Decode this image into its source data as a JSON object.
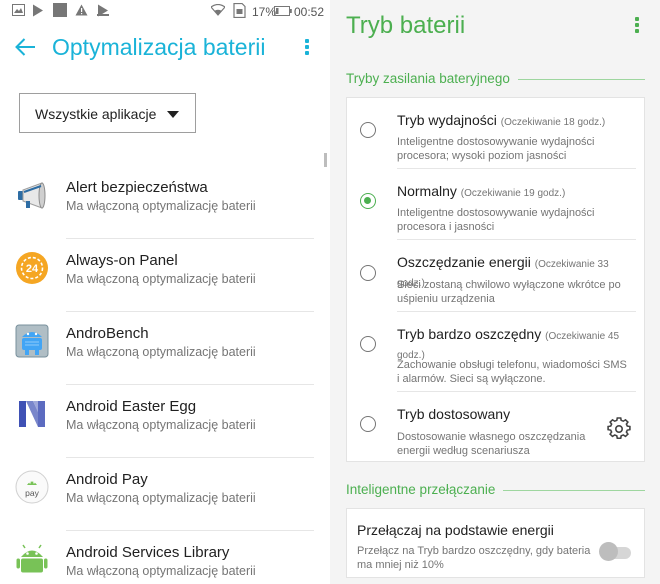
{
  "status_bar": {
    "battery_percent": "17%",
    "clock": "00:52"
  },
  "left": {
    "title": "Optymalizacja baterii",
    "filter": {
      "selected": "Wszystkie aplikacje"
    },
    "apps": [
      {
        "name": "Alert bezpieczeństwa",
        "status": "Ma włączoną optymalizację baterii",
        "icon": "megaphone-icon"
      },
      {
        "name": "Always-on Panel",
        "status": "Ma włączoną optymalizację baterii",
        "icon": "always-on-panel-icon"
      },
      {
        "name": "AndroBench",
        "status": "Ma włączoną optymalizację baterii",
        "icon": "androbench-icon"
      },
      {
        "name": "Android Easter Egg",
        "status": "Ma włączoną optymalizację baterii",
        "icon": "android-n-icon"
      },
      {
        "name": "Android Pay",
        "status": "Ma włączoną optymalizację baterii",
        "icon": "android-pay-icon"
      },
      {
        "name": "Android Services Library",
        "status": "Ma włączoną optymalizację baterii",
        "icon": "android-robot-icon"
      }
    ],
    "badges": {
      "always_on": "24",
      "pay": "pay"
    }
  },
  "right": {
    "title": "Tryb baterii",
    "section_modes": "Tryby zasilania bateryjnego",
    "modes": [
      {
        "title": "Tryb wydajności",
        "estimate": "(Oczekiwanie 18 godz.)",
        "desc": "Inteligentne dostosowywanie wydajności procesora; wysoki poziom jasności",
        "selected": false
      },
      {
        "title": "Normalny",
        "estimate": "(Oczekiwanie 19 godz.)",
        "desc": "Inteligentne dostosowywanie wydajności procesora i jasności",
        "selected": true
      },
      {
        "title": "Oszczędzanie energii",
        "estimate": "(Oczekiwanie 33 godz.)",
        "desc": "Sieci zostaną chwilowo wyłączone wkrótce po uśpieniu urządzenia",
        "selected": false
      },
      {
        "title": "Tryb bardzo oszczędny",
        "estimate": "(Oczekiwanie 45 godz.)",
        "desc": "Zachowanie obsługi telefonu, wiadomości SMS i alarmów. Sieci są wyłączone.",
        "selected": false
      },
      {
        "title": "Tryb dostosowany",
        "estimate": "",
        "desc": "Dostosowanie własnego oszczędzania energii według scenariusza",
        "selected": false
      }
    ],
    "section_smart": "Inteligentne przełączanie",
    "smart_switch": {
      "title": "Przełączaj na podstawie energii",
      "desc": "Przełącz na Tryb bardzo oszczędny, gdy bateria ma mniej niż 10%",
      "enabled": false
    }
  },
  "colors": {
    "left_accent": "#1ab3d8",
    "right_accent": "#4caf50"
  }
}
